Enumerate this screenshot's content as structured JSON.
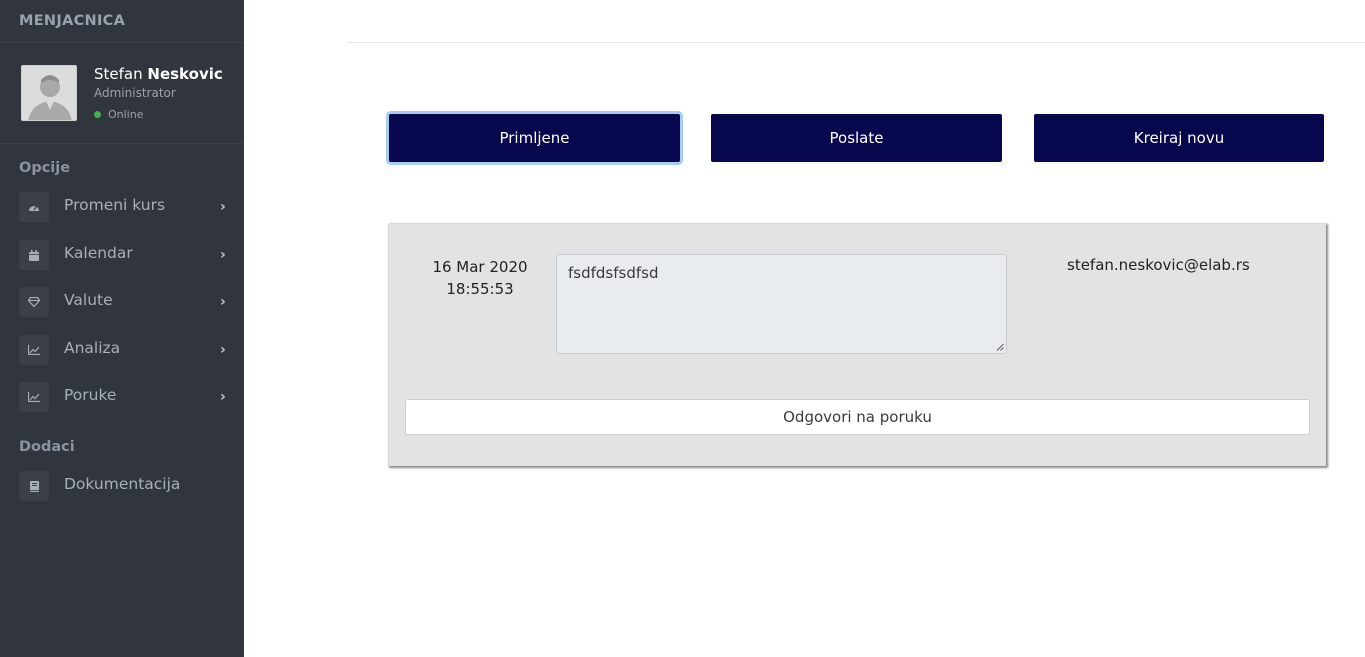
{
  "brand": "MENJACNICA",
  "user": {
    "first_name": "Stefan",
    "last_name": "Neskovic",
    "role": "Administrator",
    "status": "Online",
    "status_color": "#3fb64c"
  },
  "sidebar": {
    "section1": "Opcije",
    "items": [
      {
        "label": "Promeni kurs",
        "icon": "dashboard-gauge-icon"
      },
      {
        "label": "Kalendar",
        "icon": "calendar-icon"
      },
      {
        "label": "Valute",
        "icon": "diamond-icon"
      },
      {
        "label": "Analiza",
        "icon": "area-chart-icon"
      },
      {
        "label": "Poruke",
        "icon": "area-chart-icon"
      }
    ],
    "section2": "Dodaci",
    "extras": [
      {
        "label": "Dokumentacija",
        "icon": "book-icon"
      }
    ]
  },
  "tabs": {
    "received": "Primljene",
    "sent": "Poslate",
    "create": "Kreiraj novu"
  },
  "message": {
    "date": "16 Mar 2020",
    "time": "18:55:53",
    "body": "fsdfdsfsdfsd",
    "from": "stefan.neskovic@elab.rs",
    "reply_label": "Odgovori na poruku"
  },
  "colors": {
    "sidebar_bg": "#31353d",
    "button_bg": "#07074d",
    "card_bg": "#e3e3e3"
  }
}
